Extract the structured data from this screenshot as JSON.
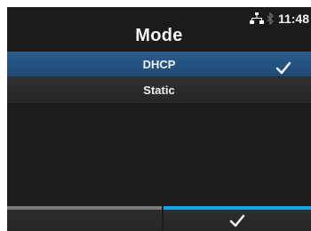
{
  "header": {
    "title": "Mode",
    "status": {
      "network_icon": "network-icon",
      "bluetooth_icon": "bluetooth-icon",
      "time": "11:48"
    }
  },
  "list": {
    "items": [
      {
        "label": "DHCP",
        "selected": true,
        "checked": true
      },
      {
        "label": "Static",
        "selected": false,
        "checked": false
      }
    ]
  },
  "footer": {
    "left_key": {
      "label": "",
      "indicator_color": "#7a7a7a"
    },
    "right_key": {
      "icon": "checkmark-icon",
      "indicator_color": "#1aa2de"
    }
  },
  "colors": {
    "background": "#1b1b1b",
    "selected_row": "#245482",
    "accent": "#1aa2de"
  }
}
